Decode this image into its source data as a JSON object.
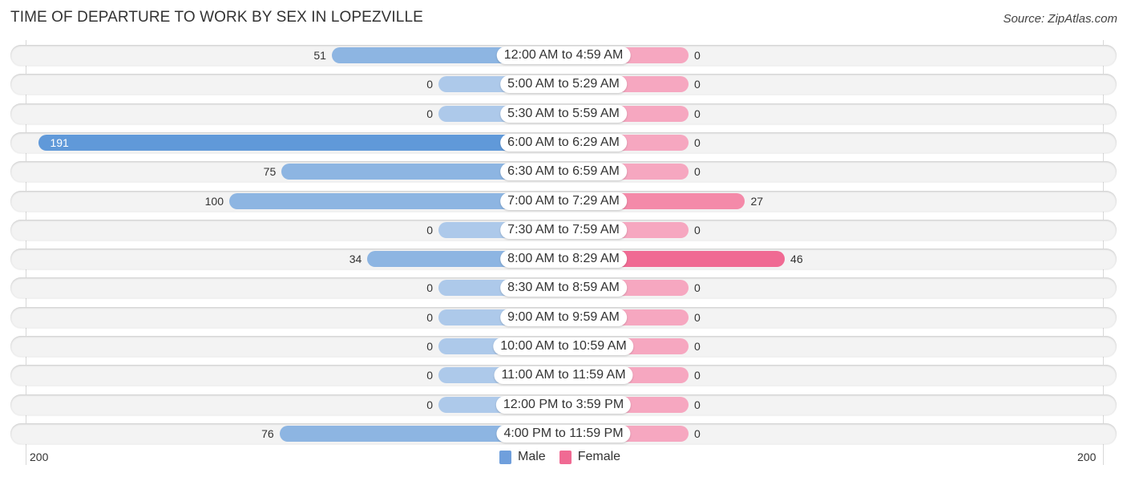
{
  "title": "TIME OF DEPARTURE TO WORK BY SEX IN LOPEZVILLE",
  "source": "Source: ZipAtlas.com",
  "colors": {
    "male": "#8db5e2",
    "male_strong": "#6099d9",
    "female": "#f6a7c0",
    "female_strong": "#f06a93"
  },
  "chart_data": {
    "type": "bar",
    "orientation": "horizontal-diverging",
    "title": "TIME OF DEPARTURE TO WORK BY SEX IN LOPEZVILLE",
    "categories": [
      "12:00 AM to 4:59 AM",
      "5:00 AM to 5:29 AM",
      "5:30 AM to 5:59 AM",
      "6:00 AM to 6:29 AM",
      "6:30 AM to 6:59 AM",
      "7:00 AM to 7:29 AM",
      "7:30 AM to 7:59 AM",
      "8:00 AM to 8:29 AM",
      "8:30 AM to 8:59 AM",
      "9:00 AM to 9:59 AM",
      "10:00 AM to 10:59 AM",
      "11:00 AM to 11:59 AM",
      "12:00 PM to 3:59 PM",
      "4:00 PM to 11:59 PM"
    ],
    "series": [
      {
        "name": "Male",
        "values": [
          51,
          0,
          0,
          191,
          75,
          100,
          0,
          34,
          0,
          0,
          0,
          0,
          0,
          76
        ]
      },
      {
        "name": "Female",
        "values": [
          0,
          0,
          0,
          0,
          0,
          27,
          0,
          46,
          0,
          0,
          0,
          0,
          0,
          0
        ]
      }
    ],
    "xlim": [
      -200,
      200
    ],
    "tick_labels": {
      "left": "200",
      "right": "200"
    },
    "legend": {
      "position": "bottom-center",
      "entries": [
        "Male",
        "Female"
      ]
    },
    "grid": false
  }
}
